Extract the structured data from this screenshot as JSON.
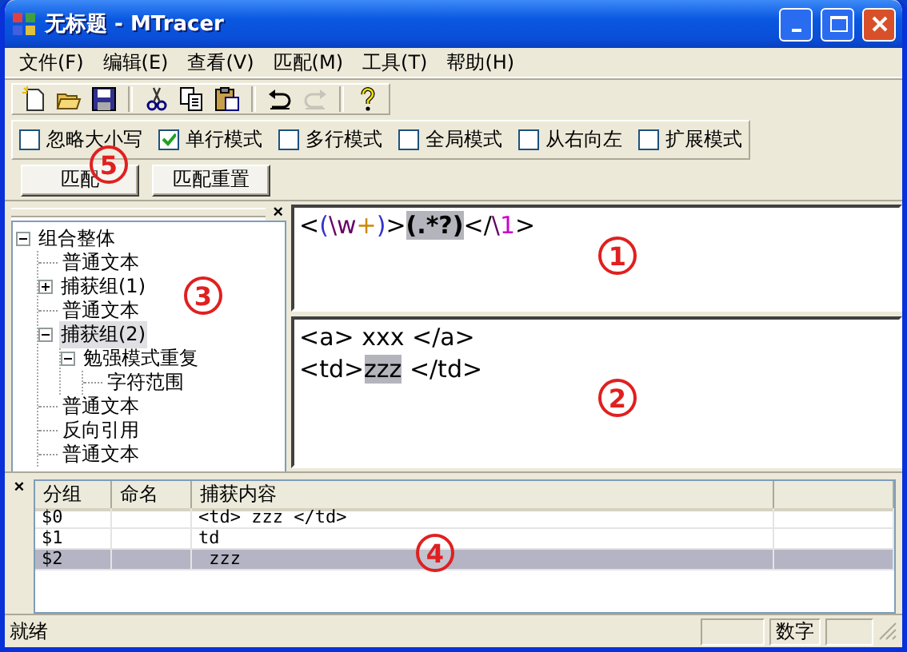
{
  "window": {
    "title": "无标题 - MTracer"
  },
  "menu": [
    "文件(F)",
    "编辑(E)",
    "查看(V)",
    "匹配(M)",
    "工具(T)",
    "帮助(H)"
  ],
  "toolbar": [
    {
      "kind": "new",
      "disabled": false
    },
    {
      "kind": "open",
      "disabled": false
    },
    {
      "kind": "save",
      "disabled": false
    },
    {
      "kind": "sep"
    },
    {
      "kind": "cut",
      "disabled": false
    },
    {
      "kind": "copy",
      "disabled": false
    },
    {
      "kind": "paste",
      "disabled": false
    },
    {
      "kind": "sep"
    },
    {
      "kind": "undo",
      "disabled": false
    },
    {
      "kind": "redo",
      "disabled": true
    },
    {
      "kind": "sep"
    },
    {
      "kind": "help",
      "disabled": false
    }
  ],
  "options": {
    "items": [
      {
        "label": "忽略大小写",
        "checked": false
      },
      {
        "label": "单行模式",
        "checked": true
      },
      {
        "label": "多行模式",
        "checked": false
      },
      {
        "label": "全局模式",
        "checked": false
      },
      {
        "label": "从右向左",
        "checked": false
      },
      {
        "label": "扩展模式",
        "checked": false
      }
    ],
    "buttons": [
      "匹配",
      "匹配重置"
    ],
    "callout": "5"
  },
  "tree": {
    "close": "×",
    "callout": "3",
    "items": [
      {
        "label": "组合整体",
        "expanded": true,
        "selected": false,
        "children": [
          {
            "label": "普通文本",
            "selected": false
          },
          {
            "label": "捕获组(1)",
            "expanded": false,
            "selected": false
          },
          {
            "label": "普通文本",
            "selected": false
          },
          {
            "label": "捕获组(2)",
            "expanded": true,
            "selected": true,
            "children": [
              {
                "label": "勉强模式重复",
                "expanded": true,
                "selected": false,
                "children": [
                  {
                    "label": "字符范围",
                    "selected": false
                  }
                ]
              }
            ]
          },
          {
            "label": "普通文本",
            "selected": false
          },
          {
            "label": "反向引用",
            "selected": false
          },
          {
            "label": "普通文本",
            "selected": false
          }
        ]
      }
    ]
  },
  "regex": {
    "callout": "1",
    "segments": [
      {
        "text": "<",
        "color": "#000000",
        "highlighted": false
      },
      {
        "text": "(",
        "color": "#3333cc",
        "highlighted": false
      },
      {
        "text": "\\w",
        "color": "#660066",
        "highlighted": false
      },
      {
        "text": "+",
        "color": "#cc8800",
        "highlighted": false
      },
      {
        "text": ")",
        "color": "#3333cc",
        "highlighted": false
      },
      {
        "text": ">",
        "color": "#000000",
        "highlighted": false
      },
      {
        "text": "(.*?)",
        "color": "#000000",
        "highlighted": true
      },
      {
        "text": "</",
        "color": "#000000",
        "highlighted": false
      },
      {
        "text": "\\",
        "color": "#660066",
        "highlighted": false
      },
      {
        "text": "1",
        "color": "#cc00cc",
        "highlighted": false
      },
      {
        "text": ">",
        "color": "#000000",
        "highlighted": false
      }
    ]
  },
  "target": {
    "callout": "2",
    "lines": [
      [
        {
          "text": "<a> xxx </a>",
          "highlighted": false
        }
      ],
      [
        {
          "text": "<td>",
          "highlighted": false
        },
        {
          "text": "zzz",
          "highlighted": true
        },
        {
          "text": " </td>",
          "highlighted": false
        }
      ]
    ]
  },
  "results": {
    "close": "×",
    "callout": "4",
    "columns": [
      "分组",
      "命名",
      "捕获内容"
    ],
    "rows": [
      {
        "cells": [
          "$0",
          "",
          "<td> zzz </td>"
        ],
        "selected": false
      },
      {
        "cells": [
          "$1",
          "",
          "td"
        ],
        "selected": false
      },
      {
        "cells": [
          "$2",
          "",
          " zzz"
        ],
        "selected": true
      }
    ]
  },
  "status_bar": {
    "text": "就绪",
    "panes": [
      {
        "kind": "blank"
      },
      {
        "kind": "text",
        "text": "数字"
      },
      {
        "kind": "blank"
      }
    ]
  }
}
